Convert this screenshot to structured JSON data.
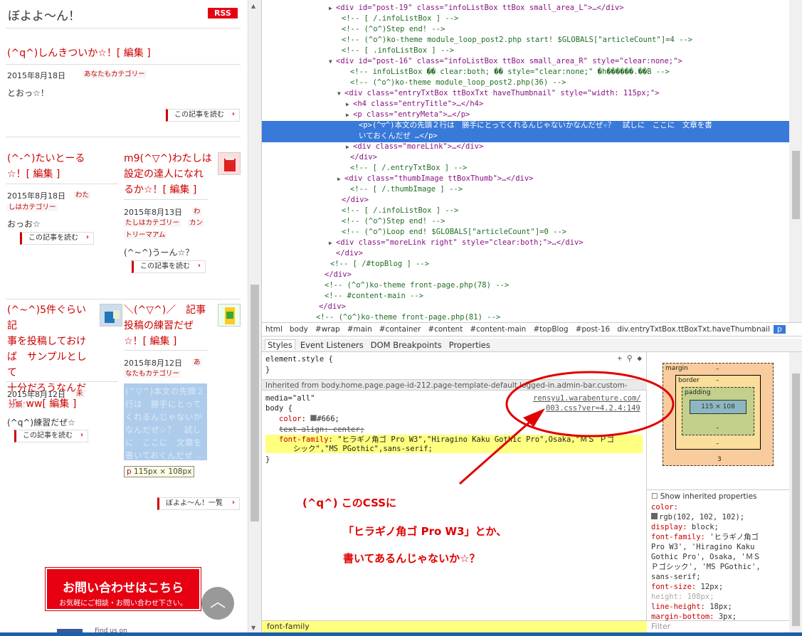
{
  "blog": {
    "title": "ぼよよ〜ん！",
    "rss": "RSS",
    "post1": {
      "title": "(^q^)しんきついか☆！",
      "edit": "[ 編集 ]",
      "date": "2015年8月18日",
      "cat": "あなたもカテゴリー",
      "body": "とおっ☆！",
      "more": "この記事を読む"
    },
    "post2": {
      "title": "(^-^)たいとーる☆！",
      "edit": "[ 編集 ]",
      "date": "2015年8月18日",
      "cat1": "わた",
      "cat2": "しはカテゴリー",
      "body": "おっお☆",
      "more": "この記事を読む"
    },
    "post3": {
      "title1": "m9(^▽^)わたしは",
      "title2": "設定の達人になれ",
      "title3": "るか☆！",
      "edit": "[ 編集 ]",
      "date": "2015年8月13日",
      "cat1": "わ",
      "cat2": "たしはカテゴリー",
      "cat3": "カン",
      "cat4": "トリーマアム",
      "body": "(^~^)うーん☆？",
      "more": "この記事を読む"
    },
    "post4": {
      "t1": "(^~^)5件ぐらい記",
      "t2": "事を投稿しておけ",
      "t3": "ば　サンプルとして",
      "t4": "十分だろうなんだ",
      "t5": "ぜ☆ww",
      "edit": "[ 編集 ]",
      "date": "2015年8月12日",
      "cat1": "未",
      "cat2": "分類",
      "body": "(^q^)練習だぜ☆",
      "more": "この記事を読む"
    },
    "post5": {
      "t1": "＼(^▽^)／　記事",
      "t2": "投稿の練習だぜ",
      "t3": "☆！",
      "edit": "[ 編集 ]",
      "date": "2015年8月12日",
      "cat1": "あ",
      "cat2": "なたもカテゴリー",
      "excerpt": "(^▽^)本文の先頭２行は　勝手にとってくれるんじゃないかなんだぜ☆？　試しに　ここに　文章を書いておくんだぜ …"
    },
    "tooltip_tag": "p",
    "tooltip_size": "115px × 108px",
    "list_link": "ぼよよ〜ん！一覧",
    "contact_l1": "お問い合わせはこちら",
    "contact_l2": "お気軽にご相談・お問い合わせ下さい。",
    "findus": "Find us on",
    "totop": "︿"
  },
  "dom": {
    "lines": [
      "<div id=\"post-19\" class=\"infoListBox ttBox small_area_L\">…</div>",
      "<!-- [ /.infoListBox ] -->",
      "<!-- (^o^)Step end! -->",
      "<!-- (^o^)ko-theme module_loop_post2.php start! $GLOBALS[\"articleCount\"]=4 -->",
      "<!-- [ .infoListBox ] -->",
      "<div id=\"post-16\" class=\"infoListBox ttBox small_area_R\" style=\"clear:none;\">",
      "<!-- infoListBox �� clear:both; �� style=\"clear:none;\" �h������.��B -->",
      "<!-- (^o^)ko-theme module_loop_post2.php(36) -->",
      "<div class=\"entryTxtBox ttBoxTxt haveThumbnail\" style=\"width: 115px;\">",
      "<h4 class=\"entryTitle\">…</h4>",
      "<p class=\"entryMeta\">…</p>",
      "<p>(^▽^)本文の先頭２行は　勝手にとってくれるんじゃないかなんだぜ☆？　試しに　ここに　文章を書",
      "いておくんだぜ …</p>",
      "<div class=\"moreLink\">…</div>",
      "</div>",
      "<!-- [ /.entryTxtBox ] -->",
      "<div class=\"thumbImage ttBoxThumb\">…</div>",
      "<!-- [ /.thumbImage ] -->",
      "</div>",
      "<!-- [ /.infoListBox ] -->",
      "<!-- (^o^)Step end! -->",
      "<!-- (^o^)Loop end! $GLOBALS[\"articleCount\"]=0 -->",
      "<div class=\"moreLink right\" style=\"clear:both;\">…</div>",
      "</div>",
      "<!-- [ /#topBlog ] -->",
      "</div>",
      "<!-- (^o^)ko-theme front-page.php(78) -->",
      "<!-- #content-main -->",
      "</div>",
      "<!-- (^o^)ko-theme front-page.php(81) -->"
    ]
  },
  "crumbs": [
    "html",
    "body",
    "#wrap",
    "#main",
    "#container",
    "#content",
    "#content-main",
    "#topBlog",
    "#post-16",
    "div.entryTxtBox.ttBoxTxt.haveThumbnail",
    "p"
  ],
  "tabs": [
    "Styles",
    "Event Listeners",
    "DOM Breakpoints",
    "Properties"
  ],
  "styles": {
    "element_style": "element.style {",
    "close1": "}",
    "inherited": "Inherited from body.home.page.page-id-212.page-template-default.logged-in.admin-bar.custom-",
    "media": "media=\"all\"",
    "src1": "rensyu1.warabenture.com/",
    "src2": "003.css?ver=4.2.4:149",
    "selector": "body {",
    "color_prop": "color",
    "color_val": "#666;",
    "ta": "text-align: center;",
    "ff_prop": "font-family",
    "ff_val1": "\"ヒラギノ角ゴ Pro W3\",\"Hiragino Kaku Gothic Pro\",Osaka,\"ＭＳ Ｐゴ",
    "ff_val2": "シック\",\"MS PGothic\",sans-serif;",
    "close2": "}"
  },
  "annotation": {
    "l1": "(^q^) このCSSに",
    "l2": "「ヒラギノ角ゴ Pro W3」とか、",
    "l3": "書いてあるんじゃないか☆？"
  },
  "footbar": "font-family",
  "filter": "Filter",
  "boxmodel": {
    "margin": "margin",
    "border": "border",
    "padding": "padding",
    "content": "115 × 108",
    "dash": "–",
    "three": "3"
  },
  "computed": {
    "show_inherited": "Show inherited properties",
    "rows": [
      [
        "color:",
        ""
      ],
      [
        "",
        "rgb(102, 102, 102);"
      ],
      [
        "display:",
        "block;"
      ],
      [
        "font-family:",
        "'ヒラギノ角ゴ"
      ],
      [
        "",
        "Pro W3', 'Hiragino Kaku"
      ],
      [
        "",
        "Gothic Pro', Osaka, 'ＭＳ"
      ],
      [
        "",
        "Ｐゴシック', 'MS PGothic',"
      ],
      [
        "",
        "sans-serif;"
      ],
      [
        "font-size:",
        "12px;"
      ],
      [
        "height:",
        "108px;"
      ],
      [
        "line-height:",
        "18px;"
      ],
      [
        "margin-bottom:",
        "3px;"
      ]
    ]
  },
  "colors": {
    "accent": "#c00",
    "selected": "#3879d9",
    "highlight": "#ffff80",
    "annotation": "#e00000"
  }
}
